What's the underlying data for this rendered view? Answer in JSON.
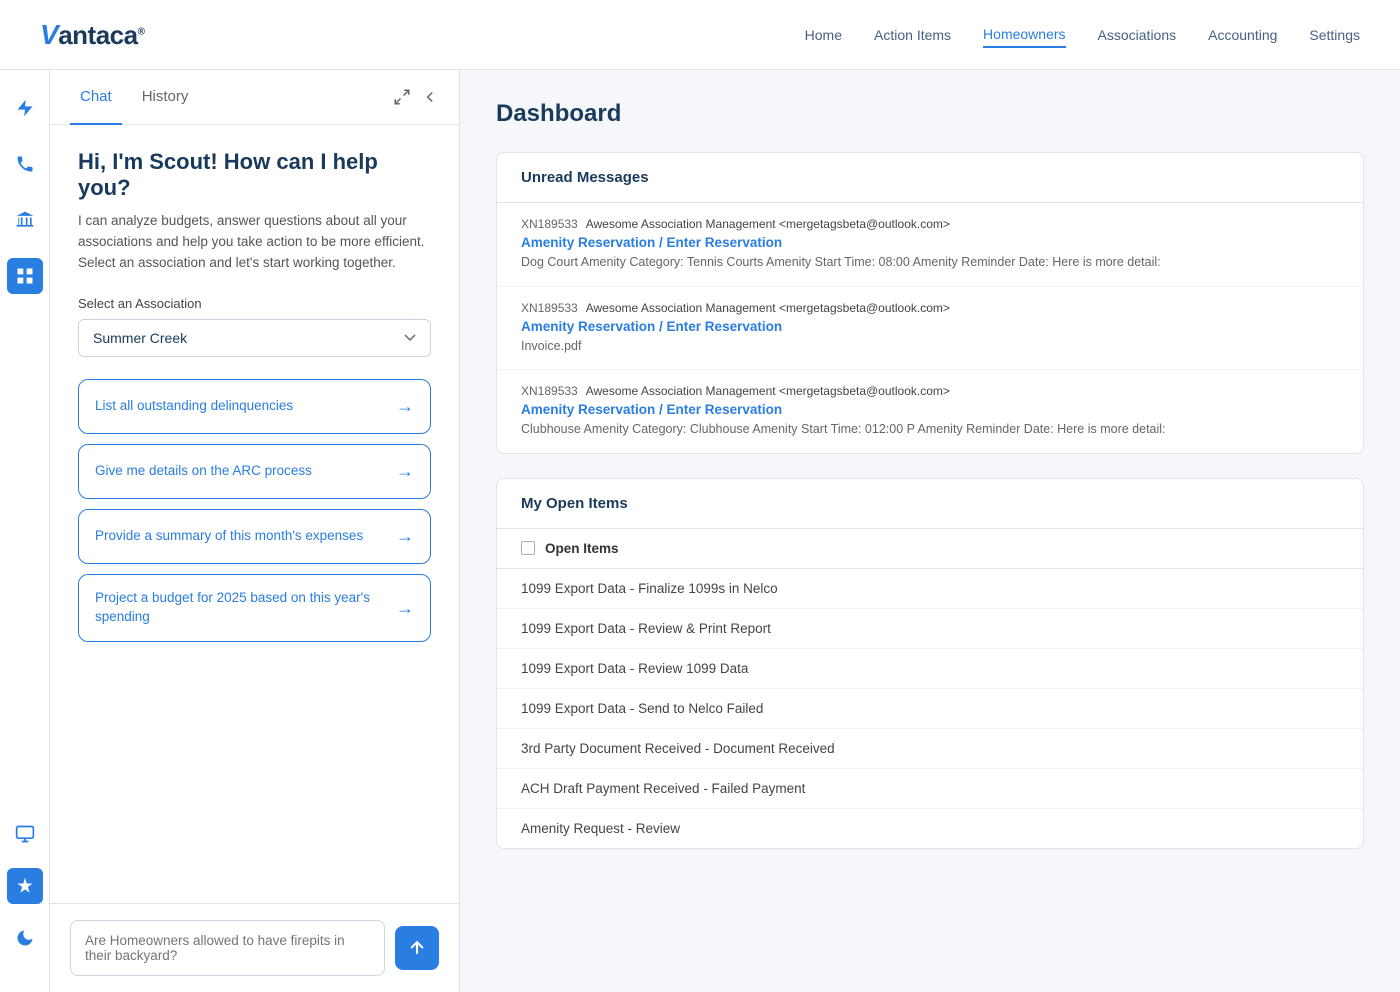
{
  "logo": {
    "text": "antaca",
    "v": "V",
    "trademark": "®"
  },
  "nav": {
    "items": [
      {
        "label": "Home",
        "active": false
      },
      {
        "label": "Action Items",
        "active": false
      },
      {
        "label": "Homeowners",
        "active": true
      },
      {
        "label": "Associations",
        "active": false
      },
      {
        "label": "Accounting",
        "active": false
      },
      {
        "label": "Settings",
        "active": false
      }
    ]
  },
  "chat_panel": {
    "tab_chat": "Chat",
    "tab_history": "History",
    "greeting_title": "Hi, I'm Scout! How can I help you?",
    "greeting_desc": "I can analyze budgets, answer questions about all your associations and help you take action to be more efficient. Select an association and let's start working together.",
    "select_label": "Select an Association",
    "selected_association": "Summer Creek",
    "suggestions": [
      {
        "text": "List all outstanding delinquencies"
      },
      {
        "text": "Give me details on the ARC process"
      },
      {
        "text": "Provide a summary of this month's expenses"
      },
      {
        "text": "Project a budget for 2025 based on this year's spending"
      }
    ],
    "input_placeholder": "Are Homeowners allowed to have firepits in their backyard?"
  },
  "dashboard": {
    "title": "Dashboard",
    "unread_messages_section": "Unread Messages",
    "messages": [
      {
        "id": "XN189533",
        "from": "Awesome Association Management <mergetagsbeta@outlook.com>",
        "subject": "Amenity Reservation / Enter Reservation",
        "preview": "Dog Court Amenity Category: Tennis Courts Amenity Start Time: 08:00 Amenity Reminder Date: Here is more detail:"
      },
      {
        "id": "XN189533",
        "from": "Awesome Association Management <mergetagsbeta@outlook.com>",
        "subject": "Amenity Reservation / Enter Reservation",
        "preview": "Invoice.pdf"
      },
      {
        "id": "XN189533",
        "from": "Awesome Association Management <mergetagsbeta@outlook.com>",
        "subject": "Amenity Reservation / Enter Reservation",
        "preview": "Clubhouse Amenity Category: Clubhouse Amenity Start Time: 012:00 P Amenity Reminder Date: Here is more detail:"
      }
    ],
    "open_items_section": "My Open Items",
    "open_items_label": "Open Items",
    "open_items": [
      "1099 Export Data - Finalize 1099s in Nelco",
      "1099 Export Data - Review & Print Report",
      "1099 Export Data - Review 1099 Data",
      "1099 Export Data - Send to Nelco Failed",
      "3rd Party Document Received - Document Received",
      "ACH Draft Payment Received - Failed Payment",
      "Amenity Request - Review"
    ]
  }
}
